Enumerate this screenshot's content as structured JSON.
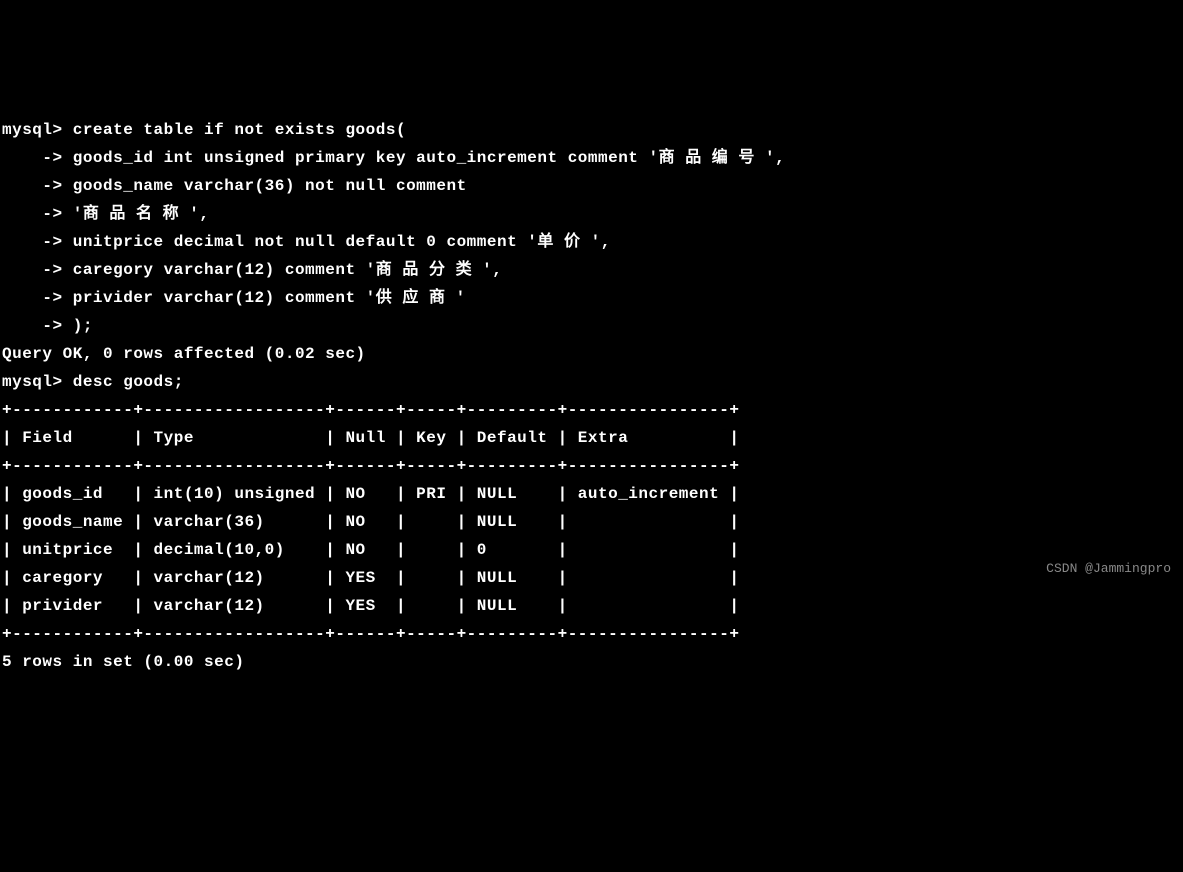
{
  "terminal": {
    "prompt": "mysql>",
    "continuation": "    ->",
    "lines": [
      "mysql> create table if not exists goods(",
      "    -> goods_id int unsigned primary key auto_increment comment '商 品 编 号 ',",
      "    -> goods_name varchar(36) not null comment",
      "    -> '商 品 名 称 ',",
      "    -> unitprice decimal not null default 0 comment '单 价 ',",
      "    -> caregory varchar(12) comment '商 品 分 类 ',",
      "    -> privider varchar(12) comment '供 应 商 '",
      "    -> );",
      "Query OK, 0 rows affected (0.02 sec)",
      "",
      "mysql> desc goods;",
      "+------------+------------------+------+-----+---------+----------------+",
      "| Field      | Type             | Null | Key | Default | Extra          |",
      "+------------+------------------+------+-----+---------+----------------+",
      "| goods_id   | int(10) unsigned | NO   | PRI | NULL    | auto_increment |",
      "| goods_name | varchar(36)      | NO   |     | NULL    |                |",
      "| unitprice  | decimal(10,0)    | NO   |     | 0       |                |",
      "| caregory   | varchar(12)      | YES  |     | NULL    |                |",
      "| privider   | varchar(12)      | YES  |     | NULL    |                |",
      "+------------+------------------+------+-----+---------+----------------+",
      "5 rows in set (0.00 sec)"
    ]
  },
  "query_result": {
    "status": "Query OK, 0 rows affected (0.02 sec)",
    "rows_message": "5 rows in set (0.00 sec)"
  },
  "table": {
    "name": "goods",
    "columns": [
      "Field",
      "Type",
      "Null",
      "Key",
      "Default",
      "Extra"
    ],
    "rows": [
      {
        "Field": "goods_id",
        "Type": "int(10) unsigned",
        "Null": "NO",
        "Key": "PRI",
        "Default": "NULL",
        "Extra": "auto_increment"
      },
      {
        "Field": "goods_name",
        "Type": "varchar(36)",
        "Null": "NO",
        "Key": "",
        "Default": "NULL",
        "Extra": ""
      },
      {
        "Field": "unitprice",
        "Type": "decimal(10,0)",
        "Null": "NO",
        "Key": "",
        "Default": "0",
        "Extra": ""
      },
      {
        "Field": "caregory",
        "Type": "varchar(12)",
        "Null": "YES",
        "Key": "",
        "Default": "NULL",
        "Extra": ""
      },
      {
        "Field": "privider",
        "Type": "varchar(12)",
        "Null": "YES",
        "Key": "",
        "Default": "NULL",
        "Extra": ""
      }
    ]
  },
  "watermark": "CSDN @Jammingpro"
}
